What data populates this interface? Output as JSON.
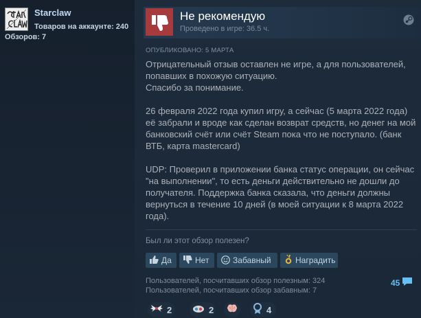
{
  "author": {
    "username": "Starclaw",
    "products_label": "Товаров на аккаунте: 240",
    "reviews_label": "Обзоров: 7",
    "avatar_text": "Star claw"
  },
  "review": {
    "verdict": "Не рекомендую",
    "hours": "Проведено в игре: 36.5 ч.",
    "posted": "ОПУБЛИКОВАНО: 5 МАРТА",
    "paragraphs": [
      [
        "Отрицательный отзыв оставлен не игре, а для пользователей, попавших в похожую ситуацию.",
        "Спасибо за понимание."
      ],
      [
        "26 февраля 2022 года купил игру, а сейчас (5 марта 2022 года) её забрали и вроде как сделан возврат средств, но денег на мой банковский счёт или счёт Steam пока что не поступало. (банк ВТБ, карта mastercard)"
      ],
      [
        "UDP: Проверил в приложении банка статус операции, он сейчас \"на выполнении\", то есть деньги действительно не дошли до получателя. Поддержка банка сказала, что деньги должны вернуться в течение 10 дней (в моей ситуации к 8 марта 2022 года)."
      ]
    ]
  },
  "feedback": {
    "question": "Был ли этот обзор полезен?",
    "yes_label": "Да",
    "no_label": "Нет",
    "funny_label": "Забавный",
    "award_label": "Наградить",
    "helpful_stat": "Пользователей, посчитавших обзор полезным: 324",
    "funny_stat": "Пользователей, посчитавших обзор забавным: 7",
    "comments": "45"
  },
  "awards": [
    {
      "icon": "wings-award-icon",
      "count": "2"
    },
    {
      "icon": "eyes-award-icon",
      "count": "2"
    },
    {
      "icon": "brain-award-icon",
      "count": ""
    },
    {
      "icon": "medal-award-icon",
      "count": "4"
    }
  ],
  "colors": {
    "background": "#1b2838",
    "thumb_down": "#a73a3d",
    "link": "#66c0f4",
    "button": "#2a475e"
  }
}
